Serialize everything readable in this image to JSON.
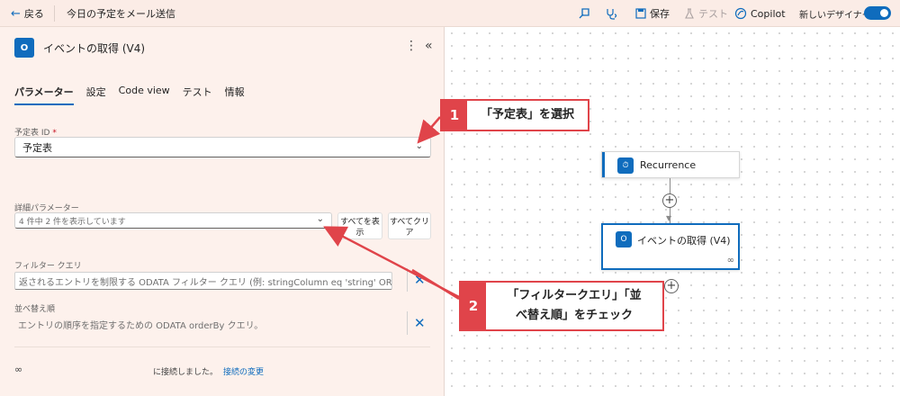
{
  "topbar": {
    "back_label": "戻る",
    "flow_name": "今日の予定をメール送信",
    "save_label": "保存",
    "test_label": "テスト",
    "copilot_label": "Copilot",
    "new_designer_label": "新しいデザイナー",
    "new_designer_on": true
  },
  "panel": {
    "title": "イベントの取得 (V4)",
    "tabs": [
      "パラメーター",
      "設定",
      "Code view",
      "テスト",
      "情報"
    ],
    "active_tab": "パラメーター",
    "calendar_label": "予定表 ID",
    "calendar_required_mark": "*",
    "calendar_value": "予定表",
    "advanced_label": "詳細パラメーター",
    "advanced_value": "4 件中 2 件を表示しています",
    "show_all_label": "すべてを表示",
    "clear_all_label": "すべてクリア",
    "filter_label": "フィルター クエリ",
    "filter_placeholder": "返されるエントリを制限する ODATA フィルター クエリ (例: stringColumn eq 'string' OR ...",
    "orderby_label": "並べ替え順",
    "orderby_placeholder": "エントリの順序を指定するための ODATA orderBy クエリ。",
    "connected_text": "に接続しました。",
    "change_connection_label": "接続の変更"
  },
  "canvas": {
    "node1_label": "Recurrence",
    "node2_label": "イベントの取得 (V4)"
  },
  "callouts": [
    {
      "number": "1",
      "text": "「予定表」を選択"
    },
    {
      "number": "2",
      "text_lines": [
        "「フィルタークエリ」「並",
        "べ替え順」をチェック"
      ]
    }
  ],
  "colors": {
    "accent": "#0f6cbd",
    "callout_red": "#e0444a",
    "panel_bg": "#fdf1ec"
  }
}
